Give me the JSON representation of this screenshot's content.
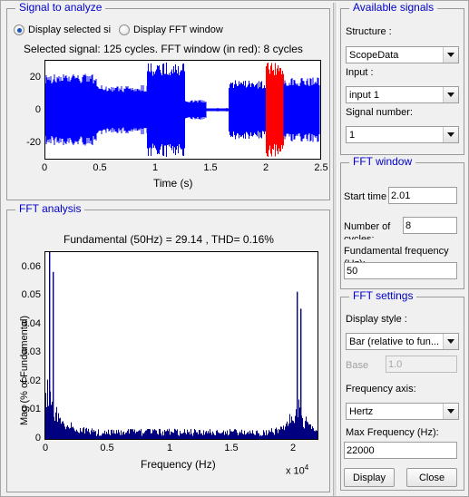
{
  "groups": {
    "signal_to_analyze": "Signal to analyze",
    "fft_analysis": "FFT analysis",
    "available_signals": "Available signals",
    "fft_window": "FFT window",
    "fft_settings": "FFT settings"
  },
  "signal_panel": {
    "radio_selected_signal": "Display selected si",
    "radio_fft_window": "Display FFT window",
    "info": "Selected signal: 125 cycles. FFT window (in red): 8 cycles"
  },
  "fft_panel": {
    "title": "Fundamental (50Hz) = 29.14 , THD= 0.16%"
  },
  "available_signals": {
    "structure_label": "Structure :",
    "structure_value": "ScopeData",
    "input_label": "Input :",
    "input_value": "input 1",
    "signal_number_label": "Signal number:",
    "signal_number_value": "1"
  },
  "fft_window": {
    "start_time_label": "Start time (s):",
    "start_time_value": "2.01",
    "number_of_label": "Number of",
    "number_of_label2": "cycles:",
    "number_of_value": "8",
    "fundamental_label": "Fundamental frequency",
    "fundamental_label2": "(Hz):",
    "fundamental_value": "50"
  },
  "fft_settings": {
    "display_style_label": "Display style :",
    "display_style_value": "Bar (relative to fun...",
    "base_label": "Base",
    "base_value": "1.0",
    "frequency_axis_label": "Frequency axis:",
    "frequency_axis_value": "Hertz",
    "max_frequency_label": "Max Frequency (Hz):",
    "max_frequency_value": "22000",
    "display_button": "Display",
    "close_button": "Close"
  },
  "colors": {
    "signal_trace": "#0000ff",
    "fft_window_trace": "#ff0000",
    "spectrum_bar": "#000080",
    "group_title": "#0000cc",
    "background": "#f0f0f0"
  },
  "chart_data": [
    {
      "type": "line",
      "name": "signal-time-plot",
      "title": "",
      "xlabel": "Time (s)",
      "ylabel": "",
      "xticks": [
        "0",
        "0.5",
        "1",
        "1.5",
        "2",
        "2.5"
      ],
      "xtickvals": [
        0,
        0.5,
        1,
        1.5,
        2,
        2.5
      ],
      "yticks": [
        "-20",
        "0",
        "20"
      ],
      "ytickvals": [
        -20,
        0,
        20
      ],
      "xlim": [
        0,
        2.5
      ],
      "ylim": [
        -30,
        30
      ],
      "grid": false,
      "legend": "none",
      "annotations": [
        "FFT window shown in red from t=2.01 to t=2.17"
      ],
      "segments": [
        {
          "t0": 0.0,
          "t1": 0.46,
          "amp": 22,
          "color": "#0000ff"
        },
        {
          "t0": 0.46,
          "t1": 0.93,
          "amp": 15,
          "color": "#0000ff"
        },
        {
          "t0": 0.93,
          "t1": 1.27,
          "amp": 29,
          "color": "#0000ff"
        },
        {
          "t0": 1.27,
          "t1": 1.46,
          "amp": 6,
          "color": "#0000ff"
        },
        {
          "t0": 1.46,
          "t1": 1.67,
          "amp": 1,
          "color": "#0000ff"
        },
        {
          "t0": 1.67,
          "t1": 2.01,
          "amp": 18,
          "color": "#0000ff"
        },
        {
          "t0": 2.01,
          "t1": 2.17,
          "amp": 29,
          "color": "#ff0000"
        },
        {
          "t0": 2.17,
          "t1": 2.5,
          "amp": 20,
          "color": "#0000ff"
        }
      ]
    },
    {
      "type": "bar",
      "name": "fft-spectrum-plot",
      "title": "Fundamental (50Hz) = 29.14 , THD= 0.16%",
      "xlabel": "Frequency (Hz)",
      "ylabel": "Mag (% of Fundamental)",
      "x_exponent": "x 10",
      "x_exponent_sup": "4",
      "xticks": [
        "0",
        "0.5",
        "1",
        "1.5",
        "2"
      ],
      "xtickvals": [
        0,
        5000,
        10000,
        15000,
        20000
      ],
      "yticks": [
        "0",
        "0.01",
        "0.02",
        "0.03",
        "0.04",
        "0.05",
        "0.06"
      ],
      "ytickvals": [
        0,
        0.01,
        0.02,
        0.03,
        0.04,
        0.05,
        0.06
      ],
      "xlim": [
        0,
        22000
      ],
      "ylim": [
        0,
        0.066
      ],
      "grid": false,
      "legend": "none",
      "peaks": [
        {
          "freq": 300,
          "mag": 0.068
        },
        {
          "freq": 600,
          "mag": 0.059
        },
        {
          "freq": 20300,
          "mag": 0.052
        },
        {
          "freq": 20600,
          "mag": 0.046
        }
      ],
      "noise_floor": 0.003
    }
  ]
}
